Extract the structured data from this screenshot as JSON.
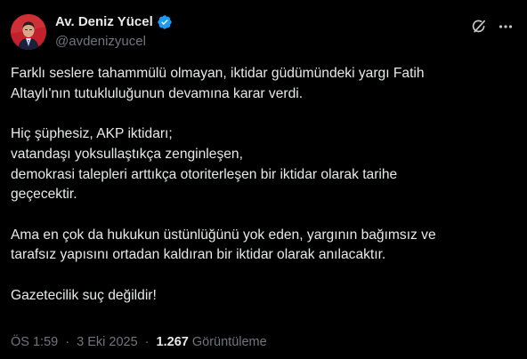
{
  "author": {
    "display_name": "Av. Deniz Yücel",
    "handle": "@avdenizyucel",
    "verified": true,
    "avatar_icon": "profile-photo",
    "verified_color": "#1d9bf0"
  },
  "header_icons": {
    "grok": "grok-icon",
    "more": "more-icon"
  },
  "tweet": {
    "paragraphs": [
      [
        "Farklı seslere tahammülü olmayan, iktidar güdümündeki yargı Fatih",
        "Altaylı'nın tutukluluğunun devamına karar verdi."
      ],
      [
        "Hiç şüphesiz, AKP iktidarı;",
        "vatandaşı yoksullaştıkça zenginleşen,",
        "demokrasi talepleri arttıkça otoriterleşen bir iktidar olarak tarihe",
        "geçecektir."
      ],
      [
        "Ama en çok da hukukun üstünlüğünü yok eden, yargının bağımsız ve",
        "tarafsız yapısını ortadan kaldıran bir iktidar olarak anılacaktır."
      ],
      [
        "Gazetecilik suç değildir!"
      ]
    ]
  },
  "meta": {
    "time": "ÖS 1:59",
    "date": "3 Eki 2025",
    "separator": "·",
    "views_count": "1.267",
    "views_label": "Görüntüleme"
  },
  "colors": {
    "background": "#000000",
    "text": "#e7e9ea",
    "secondary_text": "#71767b"
  }
}
